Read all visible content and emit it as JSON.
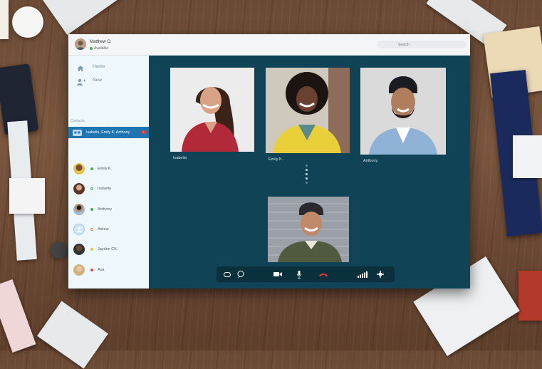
{
  "user": {
    "name": "Matthew O.",
    "status": "Available"
  },
  "search": {
    "placeholder": "Search"
  },
  "nav": [
    {
      "label": "Home",
      "icon": "home-icon"
    },
    {
      "label": "New",
      "icon": "new-contact-icon"
    }
  ],
  "contacts_header": "Contacts",
  "active_chat": {
    "label": "Isabella, Emily K, Anthony",
    "icon": "group-chat-icon"
  },
  "contacts": [
    {
      "name": "Emily K.",
      "status": "online"
    },
    {
      "name": "Isabella",
      "status": "online-outline"
    },
    {
      "name": "Anthony",
      "status": "online"
    },
    {
      "name": "Adrew",
      "status": "offline"
    },
    {
      "name": "Jayden CK.",
      "status": "away"
    },
    {
      "name": "Ava",
      "status": "busy"
    }
  ],
  "participants": [
    {
      "caption": "Isabella"
    },
    {
      "caption": "Emily K."
    },
    {
      "caption": "Anthony"
    },
    {
      "caption": ""
    }
  ],
  "controls": [
    "chat-icon",
    "message-icon",
    "video-icon",
    "microphone-icon",
    "end-call-icon",
    "signal-icon",
    "settings-icon"
  ],
  "colors": {
    "accent": "#1f74b4",
    "stage": "#0f4355",
    "online": "#3cb54a",
    "away": "#f2c02c",
    "busy": "#e0483c",
    "end_call": "#d8352b"
  }
}
